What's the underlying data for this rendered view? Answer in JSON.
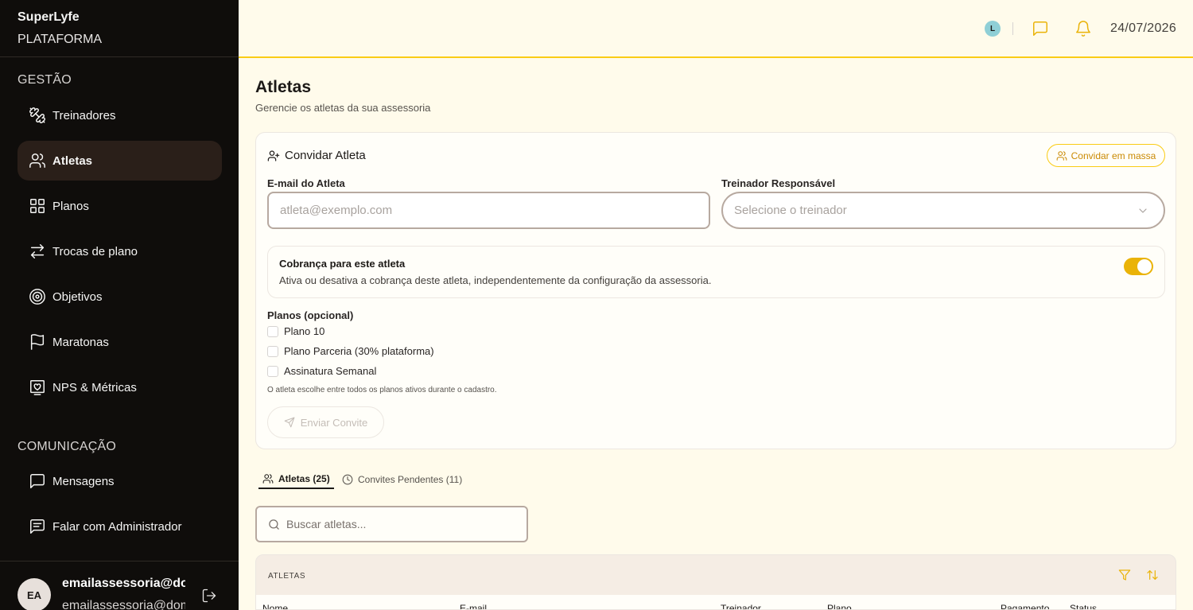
{
  "brand": {
    "name": "SuperLyfe",
    "subtitle": "PLATAFORMA"
  },
  "sidebar": {
    "sections": [
      {
        "title": "GESTÃO"
      },
      {
        "title": "COMUNICAÇÃO"
      }
    ],
    "items": [
      {
        "label": "Treinadores",
        "icon": "dumbbell-icon"
      },
      {
        "label": "Atletas",
        "icon": "users-icon",
        "active": true
      },
      {
        "label": "Planos",
        "icon": "grid-icon"
      },
      {
        "label": "Trocas de plano",
        "icon": "swap-icon"
      },
      {
        "label": "Objetivos",
        "icon": "target-icon"
      },
      {
        "label": "Maratonas",
        "icon": "flag-icon"
      },
      {
        "label": "NPS & Métricas",
        "icon": "heart-monitor-icon"
      },
      {
        "label": "Mensagens",
        "icon": "message-icon"
      },
      {
        "label": "Falar com Administrador",
        "icon": "message-text-icon"
      }
    ],
    "user": {
      "initials": "EA",
      "name": "emailassessoria@dominio.com",
      "email": "emailassessoria@dominio.com"
    }
  },
  "header": {
    "avatar_initial": "L",
    "date": "24/07/2026"
  },
  "page": {
    "title": "Atletas",
    "subtitle": "Gerencie os atletas da sua assessoria"
  },
  "invite": {
    "title": "Convidar Atleta",
    "mass_invite_label": "Convidar em massa",
    "email_label": "E-mail do Atleta",
    "email_placeholder": "atleta@exemplo.com",
    "email_value": "",
    "trainer_label": "Treinador Responsável",
    "trainer_placeholder": "Selecione o treinador",
    "billing_title": "Cobrança para este atleta",
    "billing_desc": "Ativa ou desativa a cobrança deste atleta, independentemente da configuração da assessoria.",
    "billing_enabled": true,
    "plans_label": "Planos (opcional)",
    "plans": [
      "Plano 10",
      "Plano Parceria (30% plataforma)",
      "Assinatura Semanal"
    ],
    "plans_hint": "O atleta escolhe entre todos os planos ativos durante o cadastro.",
    "send_label": "Enviar Convite"
  },
  "tabs": [
    {
      "label": "Atletas (25)",
      "active": true
    },
    {
      "label": "Convites Pendentes (11)",
      "active": false
    }
  ],
  "search": {
    "placeholder": "Buscar atletas..."
  },
  "table": {
    "caption": "ATLETAS",
    "columns": [
      "Nome",
      "E-mail",
      "Treinador",
      "Plano",
      "Pagamento",
      "Status"
    ]
  },
  "colors": {
    "accent": "#eab308",
    "sidebar_bg": "#0f0d0b",
    "page_bg": "#fffbeb"
  }
}
